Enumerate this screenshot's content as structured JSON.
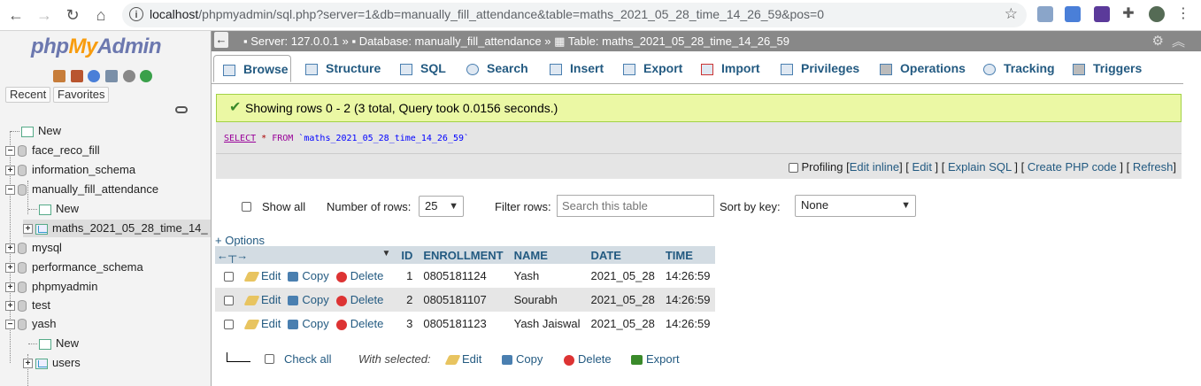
{
  "browser": {
    "url_host": "localhost",
    "url_rest": "/phpmyadmin/sql.php?server=1&db=manually_fill_attendance&table=maths_2021_05_28_time_14_26_59&pos=0"
  },
  "sidebar": {
    "logo": {
      "php": "php",
      "my": "My",
      "admin": "Admin"
    },
    "recent_label": "Recent",
    "favorites_label": "Favorites",
    "tree": [
      {
        "label": "New",
        "kind": "new"
      },
      {
        "label": "face_reco_fill",
        "kind": "db",
        "expander": "−"
      },
      {
        "label": "information_schema",
        "kind": "db",
        "expander": "+"
      },
      {
        "label": "manually_fill_attendance",
        "kind": "db",
        "expander": "−"
      },
      {
        "label": "New",
        "kind": "new"
      },
      {
        "label": "maths_2021_05_28_time_14_",
        "kind": "table",
        "expander": "+"
      },
      {
        "label": "mysql",
        "kind": "db",
        "expander": "+"
      },
      {
        "label": "performance_schema",
        "kind": "db",
        "expander": "+"
      },
      {
        "label": "phpmyadmin",
        "kind": "db",
        "expander": "+"
      },
      {
        "label": "test",
        "kind": "db",
        "expander": "+"
      },
      {
        "label": "yash",
        "kind": "db",
        "expander": "−"
      },
      {
        "label": "New",
        "kind": "new"
      },
      {
        "label": "users",
        "kind": "table",
        "expander": "+"
      }
    ]
  },
  "breadcrumb": {
    "server": "Server: 127.0.0.1",
    "database": "Database: manually_fill_attendance",
    "table": "Table: maths_2021_05_28_time_14_26_59",
    "sep": "»"
  },
  "tabs": [
    {
      "label": "Browse",
      "icon": "browse-icon",
      "active": true
    },
    {
      "label": "Structure",
      "icon": "structure-icon"
    },
    {
      "label": "SQL",
      "icon": "sql-icon"
    },
    {
      "label": "Search",
      "icon": "search-icon"
    },
    {
      "label": "Insert",
      "icon": "insert-icon"
    },
    {
      "label": "Export",
      "icon": "export-icon"
    },
    {
      "label": "Import",
      "icon": "import-icon"
    },
    {
      "label": "Privileges",
      "icon": "privileges-icon"
    },
    {
      "label": "Operations",
      "icon": "operations-icon"
    },
    {
      "label": "Tracking",
      "icon": "tracking-icon"
    },
    {
      "label": "Triggers",
      "icon": "triggers-icon"
    }
  ],
  "message": {
    "success": "Showing rows 0 - 2 (3 total, Query took 0.0156 seconds.)"
  },
  "query": {
    "select": "SELECT",
    "star": "*",
    "from": "FROM",
    "table": "`maths_2021_05_28_time_14_26_59`"
  },
  "profiling": {
    "label": "Profiling",
    "edit_inline": "Edit inline",
    "edit": "Edit",
    "explain": "Explain SQL",
    "php": "Create PHP code",
    "refresh": "Refresh"
  },
  "controls": {
    "show_all": "Show all",
    "rows_label": "Number of rows:",
    "rows_value": "25",
    "filter_label": "Filter rows:",
    "filter_placeholder": "Search this table",
    "sort_label": "Sort by key:",
    "sort_value": "None",
    "options_link": "+ Options"
  },
  "table": {
    "columns": [
      "ID",
      "ENROLLMENT",
      "NAME",
      "DATE",
      "TIME"
    ],
    "actions": {
      "edit": "Edit",
      "copy": "Copy",
      "delete": "Delete"
    },
    "rows": [
      [
        "1",
        "0805181124",
        "Yash",
        "2021_05_28",
        "14:26:59"
      ],
      [
        "2",
        "0805181107",
        "Sourabh",
        "2021_05_28",
        "14:26:59"
      ],
      [
        "3",
        "0805181123",
        "Yash Jaiswal",
        "2021_05_28",
        "14:26:59"
      ]
    ]
  },
  "bulk": {
    "check_all": "Check all",
    "with_selected": "With selected:",
    "edit": "Edit",
    "copy": "Copy",
    "delete": "Delete",
    "export": "Export"
  }
}
